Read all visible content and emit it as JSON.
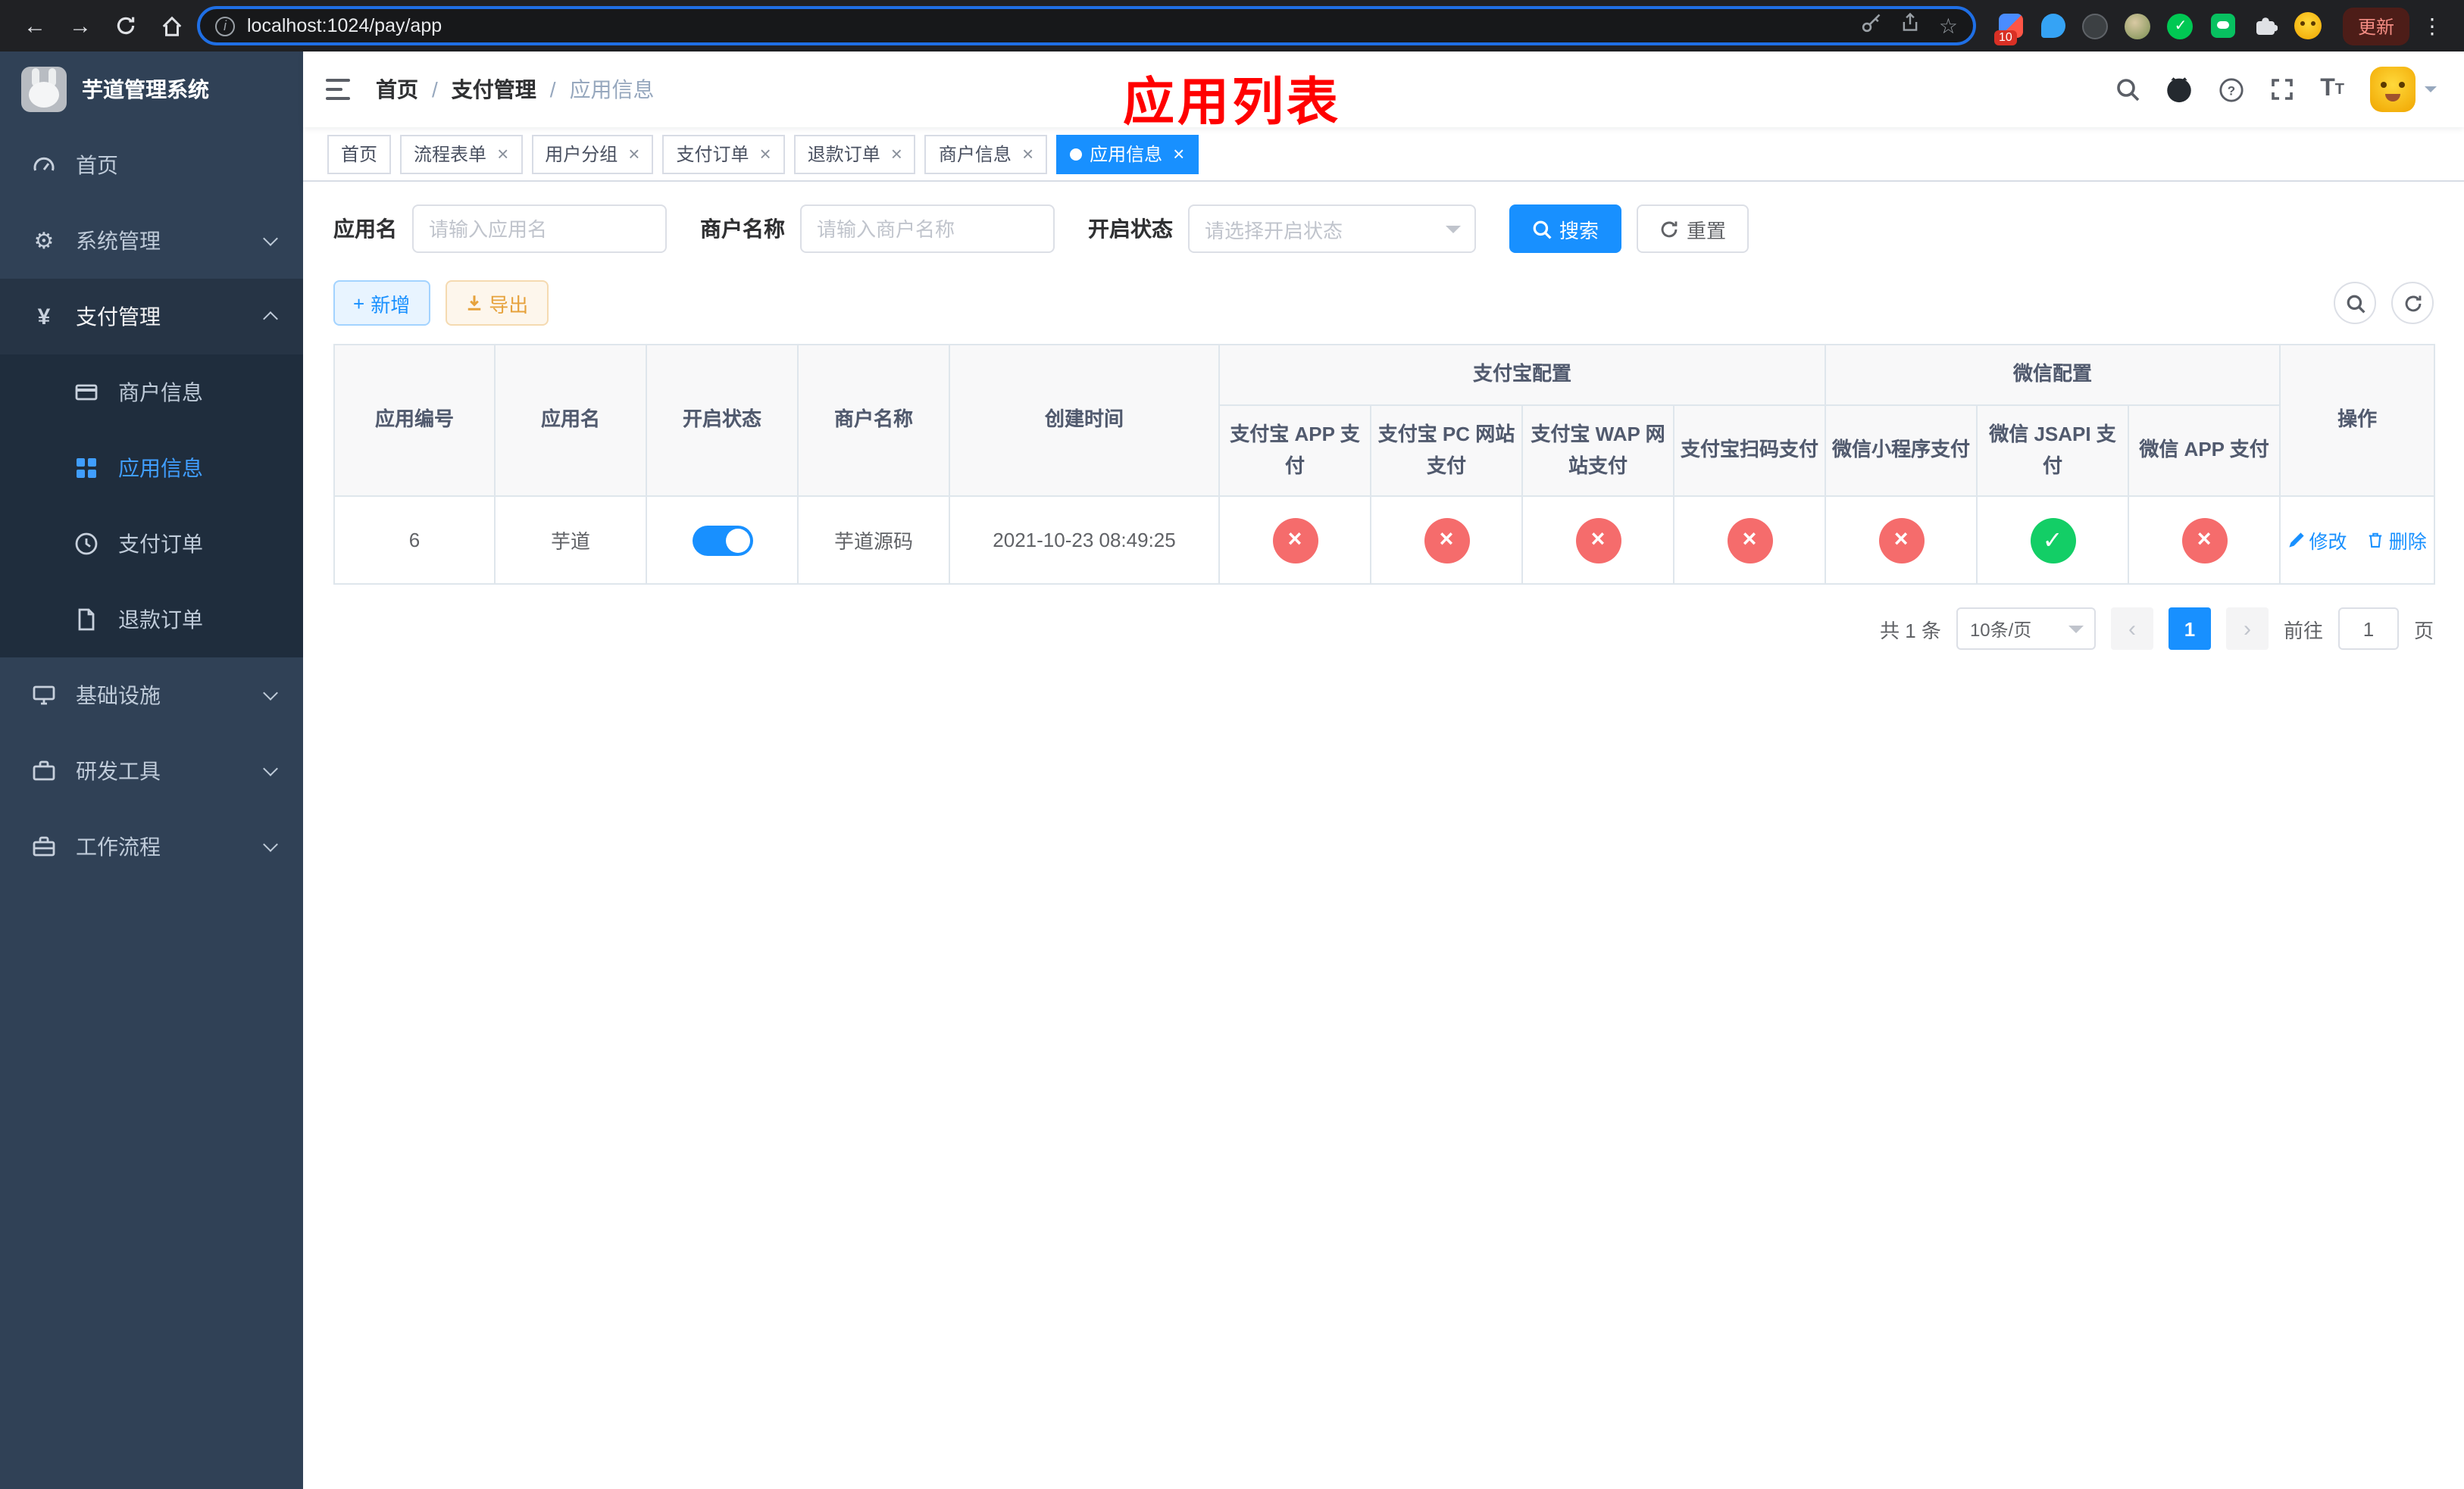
{
  "colors": {
    "accent": "#1890ff",
    "success": "#13ce66",
    "danger": "#f56c6c",
    "sidebar_bg": "#304156",
    "sidebar_sub_bg": "#1f2d3d",
    "annotation_red": "#ff0000"
  },
  "browser": {
    "url": "localhost:1024/pay/app",
    "update_label": "更新",
    "extension_badge": "10"
  },
  "sidebar": {
    "app_title": "芋道管理系统",
    "items": {
      "home": "首页",
      "system": "系统管理",
      "payment": "支付管理",
      "infra": "基础设施",
      "devtools": "研发工具",
      "workflow": "工作流程"
    },
    "payment_children": {
      "merchant": "商户信息",
      "app": "应用信息",
      "order": "支付订单",
      "refund": "退款订单"
    }
  },
  "navbar": {
    "breadcrumb": [
      "首页",
      "支付管理",
      "应用信息"
    ],
    "annotation_title": "应用列表"
  },
  "tabs": [
    {
      "label": "首页"
    },
    {
      "label": "流程表单"
    },
    {
      "label": "用户分组"
    },
    {
      "label": "支付订单"
    },
    {
      "label": "退款订单"
    },
    {
      "label": "商户信息"
    },
    {
      "label": "应用信息"
    }
  ],
  "filters": {
    "app_name_label": "应用名",
    "app_name_placeholder": "请输入应用名",
    "merchant_label": "商户名称",
    "merchant_placeholder": "请输入商户名称",
    "status_label": "开启状态",
    "status_placeholder": "请选择开启状态",
    "search_label": "搜索",
    "reset_label": "重置"
  },
  "toolbar": {
    "add_label": "新增",
    "export_label": "导出"
  },
  "table": {
    "col_id": "应用编号",
    "col_name": "应用名",
    "col_status": "开启状态",
    "col_merchant": "商户名称",
    "col_created": "创建时间",
    "group_alipay": "支付宝配置",
    "group_wechat": "微信配置",
    "col_alipay_app": "支付宝 APP 支付",
    "col_alipay_pc": "支付宝 PC 网站支付",
    "col_alipay_wap": "支付宝 WAP 网站支付",
    "col_alipay_qr": "支付宝扫码支付",
    "col_wx_mini": "微信小程序支付",
    "col_wx_jsapi": "微信 JSAPI 支付",
    "col_wx_app": "微信 APP 支付",
    "col_action": "操作",
    "row": {
      "id": "6",
      "name": "芋道",
      "enabled": true,
      "merchant": "芋道源码",
      "created": "2021-10-23 08:49:25",
      "statuses": [
        "fail",
        "fail",
        "fail",
        "fail",
        "fail",
        "success",
        "fail"
      ],
      "edit_label": "修改",
      "delete_label": "删除"
    }
  },
  "pagination": {
    "total_text": "共 1 条",
    "page_size_text": "10条/页",
    "current_page": "1",
    "goto_prefix": "前往",
    "goto_value": "1",
    "goto_suffix": "页"
  }
}
